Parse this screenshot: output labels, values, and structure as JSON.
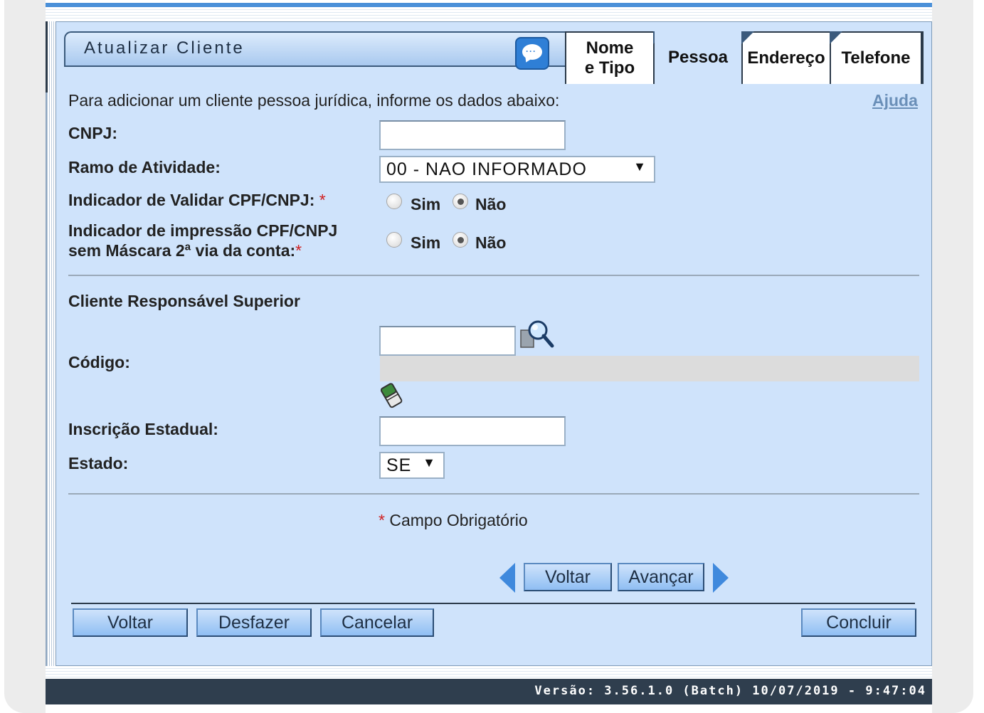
{
  "window": {
    "title": "Atualizar Cliente",
    "version": "Versão: 3.56.1.0 (Batch) 10/07/2019 - 9:47:04"
  },
  "tabs": [
    {
      "label": "Nome e Tipo",
      "active": false
    },
    {
      "label": "Pessoa",
      "active": true
    },
    {
      "label": "Endereço",
      "active": false
    },
    {
      "label": "Telefone",
      "active": false
    }
  ],
  "form": {
    "intro": "Para adicionar um cliente pessoa jurídica, informe os dados abaixo:",
    "help_link": "Ajuda",
    "cnpj_label": "CNPJ:",
    "cnpj_value": "",
    "ramo_label": "Ramo de Atividade:",
    "ramo_value": "00 - NAO INFORMADO",
    "validar_label": "Indicador de Validar CPF/CNPJ:",
    "impressao_label_1": "Indicador de impressão CPF/CNPJ",
    "impressao_label_2": "sem Máscara 2ª via da conta:",
    "required_mark": "*",
    "option_sim": "Sim",
    "option_nao": "Não",
    "validar_selected": "Não",
    "impressao_selected": "Não",
    "section_title": "Cliente Responsável Superior",
    "codigo_label": "Código:",
    "codigo_value": "",
    "inscricao_label": "Inscrição Estadual:",
    "inscricao_value": "",
    "estado_label": "Estado:",
    "estado_value": "SE",
    "required_note": "Campo Obrigatório"
  },
  "nav_buttons": {
    "back": "Voltar",
    "next": "Avançar"
  },
  "action_buttons": {
    "voltar": "Voltar",
    "desfazer": "Desfazer",
    "cancelar": "Cancelar",
    "concluir": "Concluir"
  },
  "colors": {
    "panel": "#cfe3fb",
    "accent": "#3f89dd",
    "required": "#d02020",
    "version_bar": "#2f3e4e"
  }
}
